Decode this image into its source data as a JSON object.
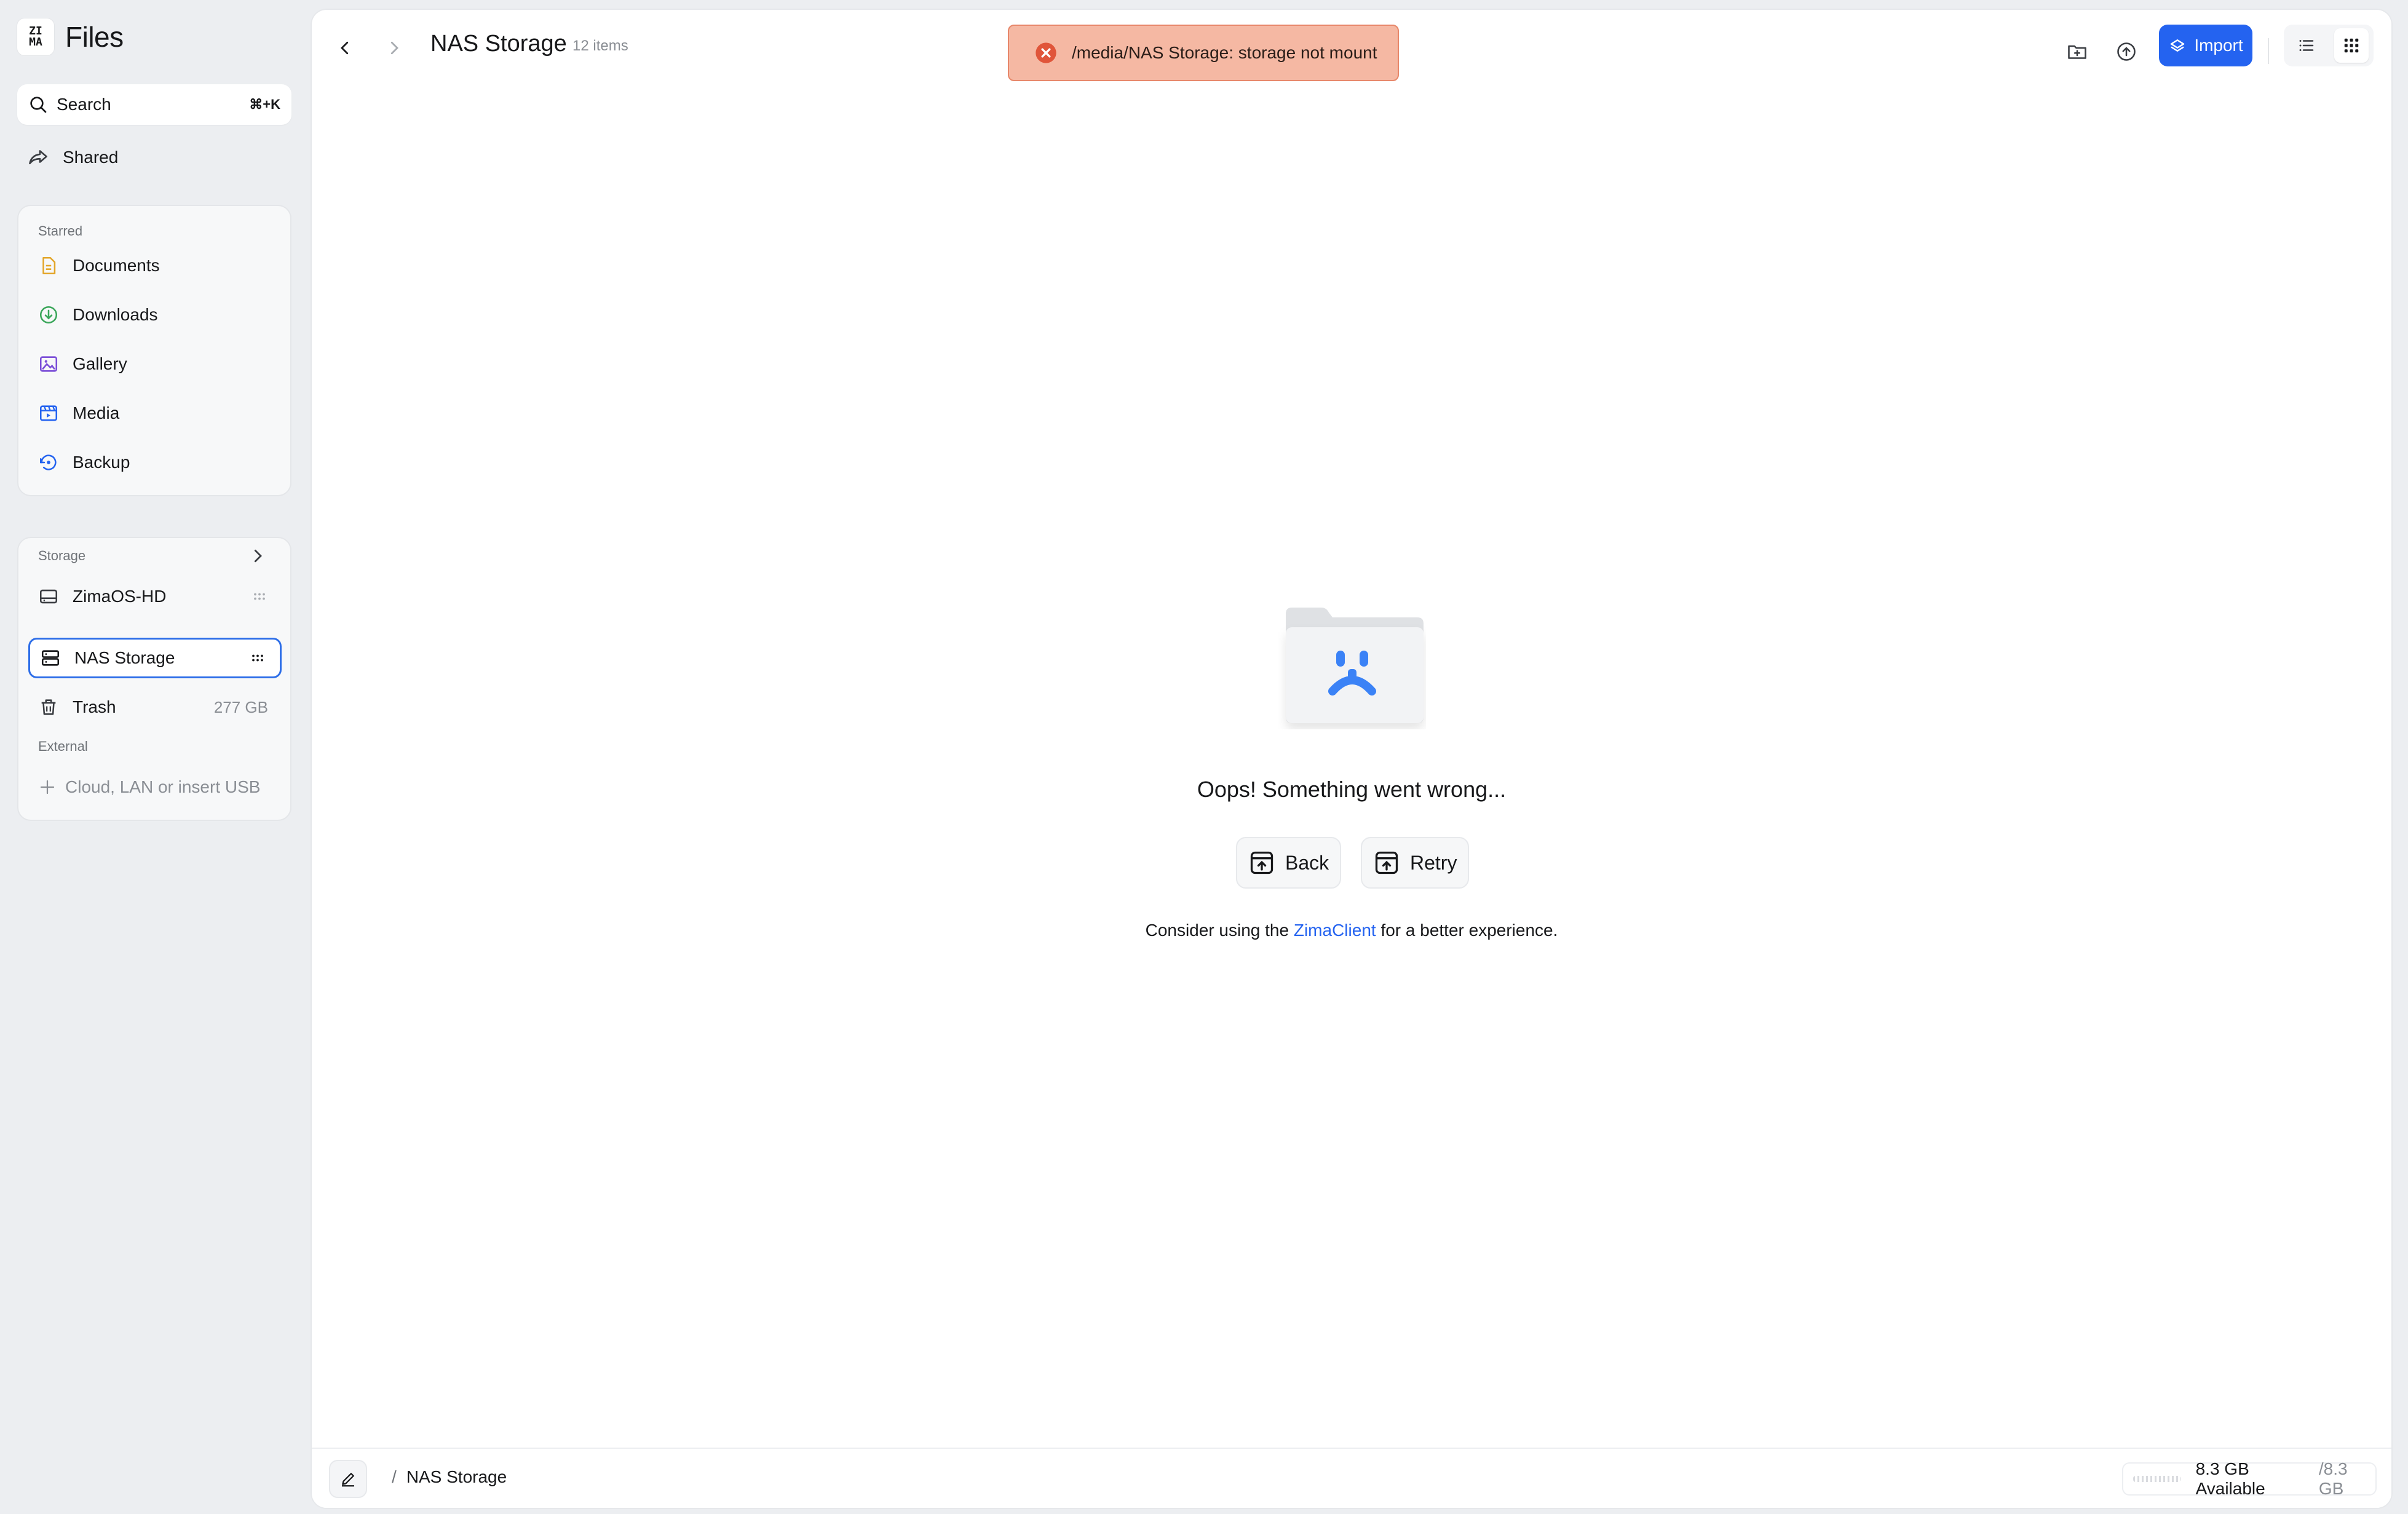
{
  "app": {
    "name": "Files",
    "logo_top": "ZI",
    "logo_bottom": "MA"
  },
  "sidebar": {
    "search": {
      "label": "Search",
      "shortcut": "⌘+K"
    },
    "shared_label": "Shared",
    "starred": {
      "title": "Starred",
      "items": [
        {
          "label": "Documents",
          "icon": "document-icon",
          "color": "#e3a62a"
        },
        {
          "label": "Downloads",
          "icon": "download-icon",
          "color": "#3aa65a"
        },
        {
          "label": "Gallery",
          "icon": "gallery-icon",
          "color": "#7b4fd8"
        },
        {
          "label": "Media",
          "icon": "media-icon",
          "color": "#2463f0"
        },
        {
          "label": "Backup",
          "icon": "backup-icon",
          "color": "#2463f0"
        }
      ]
    },
    "storage": {
      "title": "Storage",
      "items": [
        {
          "label": "ZimaOS-HD",
          "icon": "drive-icon"
        },
        {
          "label": "NAS Storage",
          "icon": "nas-icon",
          "active": true
        },
        {
          "label": "Trash",
          "icon": "trash-icon",
          "size": "277 GB"
        }
      ],
      "external_title": "External",
      "external_add": "Cloud, LAN or insert USB"
    }
  },
  "header": {
    "title": "NAS Storage",
    "count": "12 items",
    "import_label": "Import"
  },
  "toast": {
    "message": "/media/NAS Storage: storage not mount",
    "type": "error"
  },
  "empty": {
    "message": "Oops! Something went wrong...",
    "back_label": "Back",
    "retry_label": "Retry",
    "hint_prefix": "Consider using the",
    "hint_link": "ZimaClient",
    "hint_suffix": "for a better experience."
  },
  "footer": {
    "path_sep": "/",
    "path": "NAS Storage",
    "available": "8.3 GB Available",
    "total": "/8.3 GB"
  },
  "colors": {
    "accent": "#2463f0",
    "toast_bg": "#f5b8a3",
    "toast_icon": "#e0553a"
  }
}
